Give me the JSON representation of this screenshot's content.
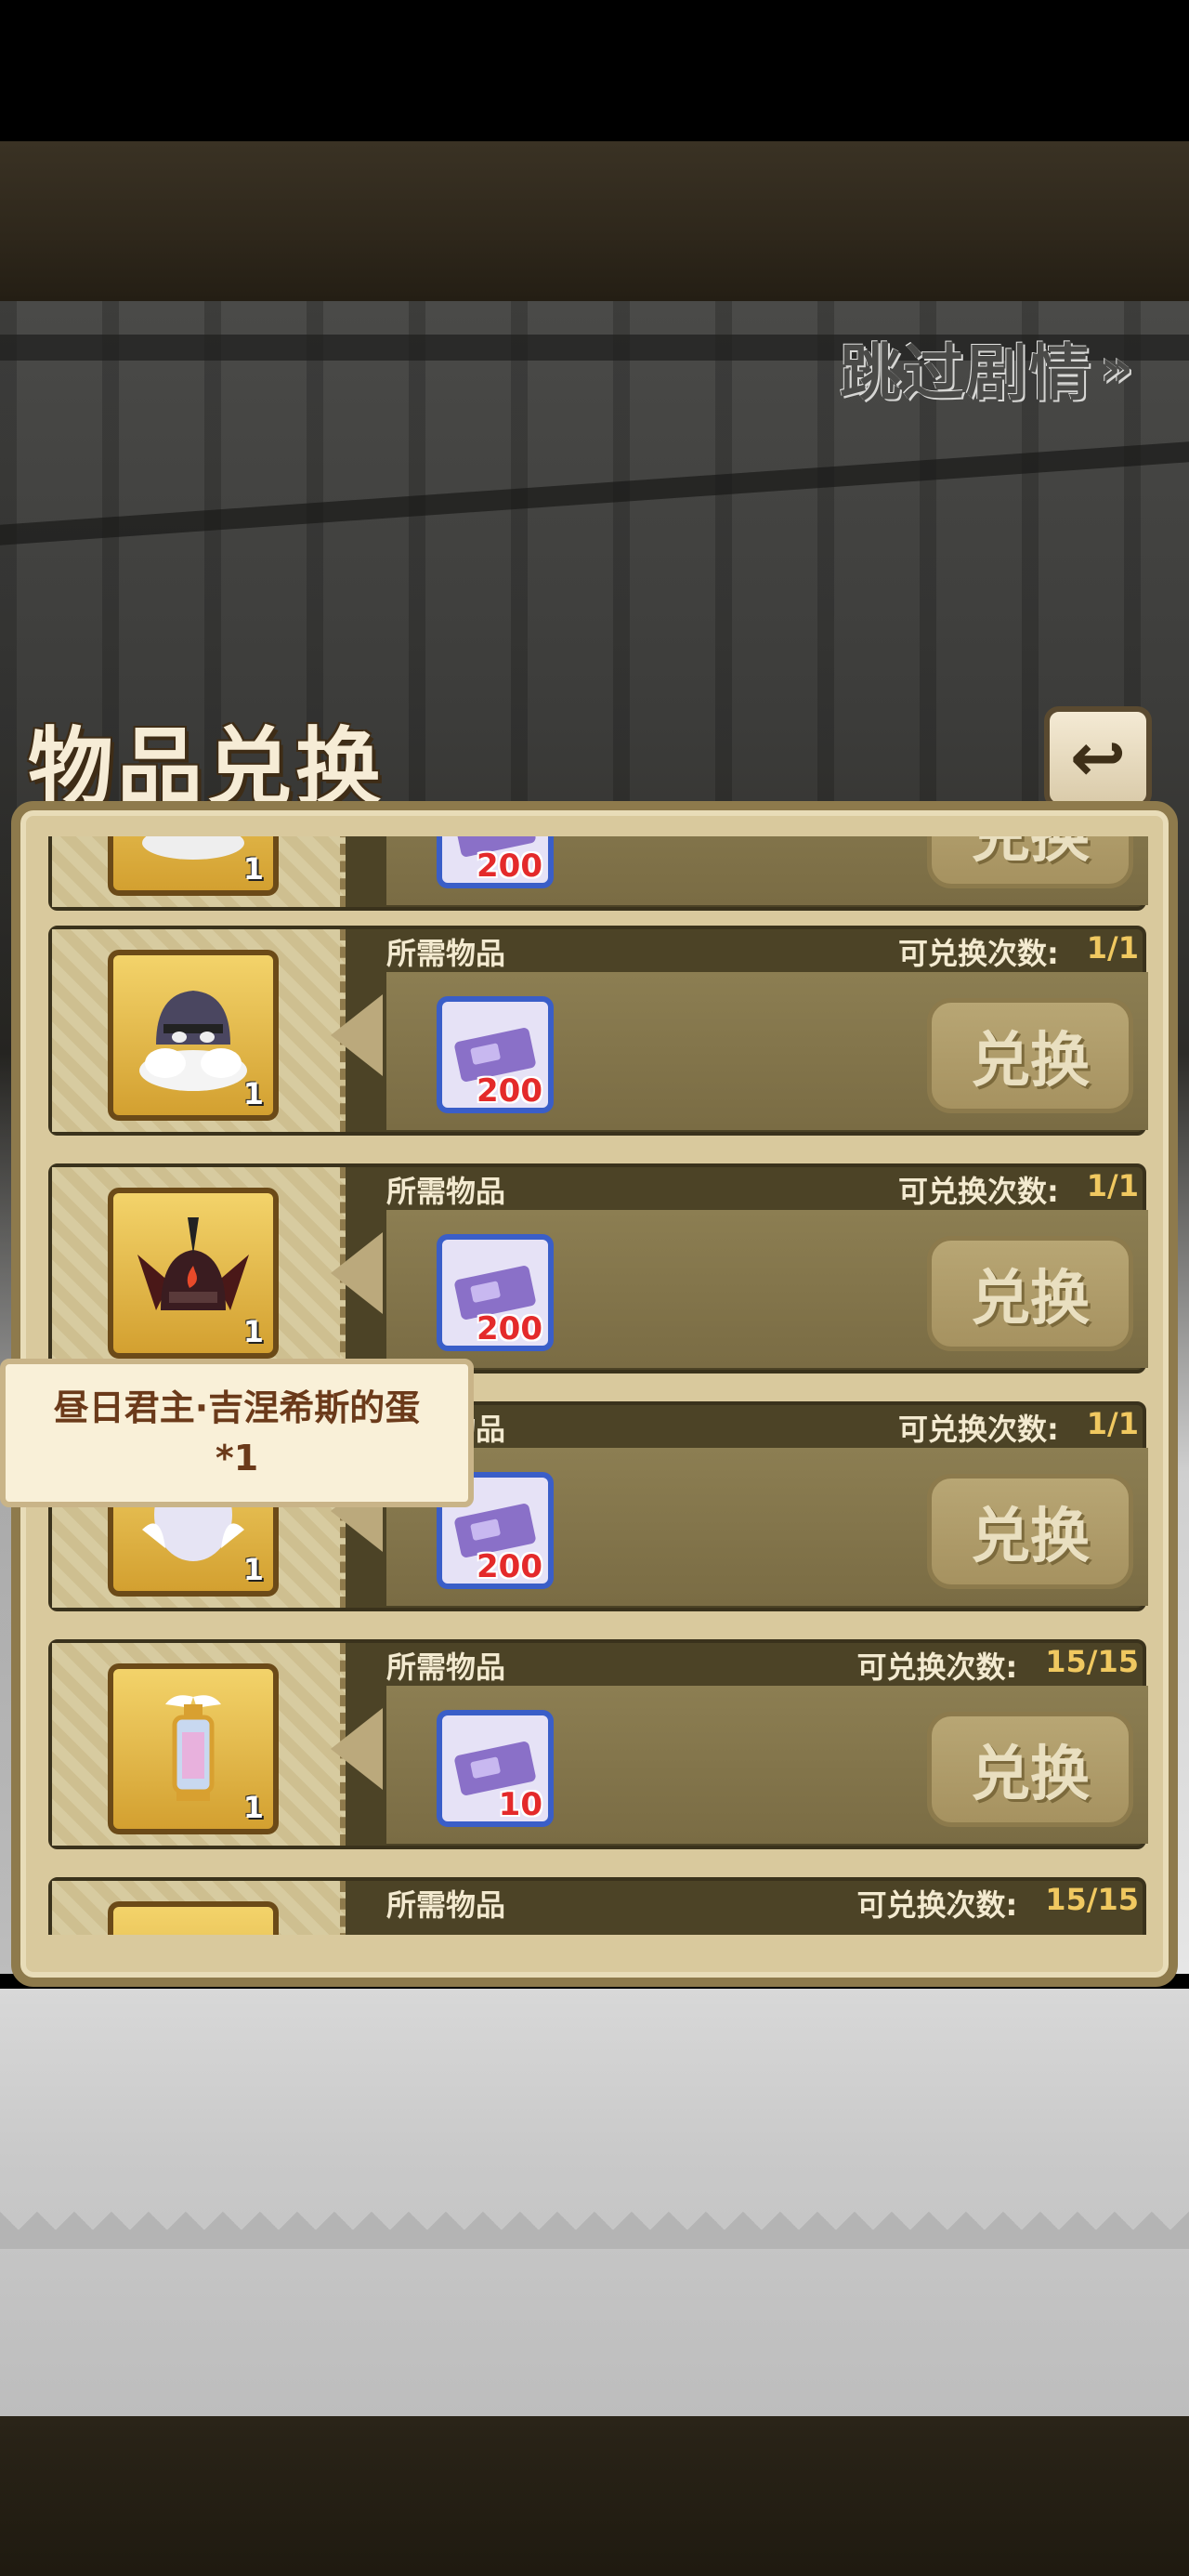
{
  "skip_button": {
    "label": "跳过剧情",
    "chevron": "»"
  },
  "title": "物品兑换",
  "back_icon": "↩",
  "header_labels": {
    "required": "所需物品",
    "times": "可兑换次数:"
  },
  "exchange_label": "兑换",
  "rows": [
    {
      "item_icon": "hood-egg-icon",
      "item_count": "1",
      "cost": "200",
      "times": ""
    },
    {
      "item_icon": "hooded-cloud-icon",
      "item_count": "1",
      "cost": "200",
      "times": "1/1"
    },
    {
      "item_icon": "demon-helm-icon",
      "item_count": "1",
      "cost": "200",
      "times": "1/1"
    },
    {
      "item_icon": "white-egg-icon",
      "item_count": "1",
      "cost": "200",
      "times": "1/1"
    },
    {
      "item_icon": "winged-lantern-icon",
      "item_count": "1",
      "cost": "10",
      "times": "15/15"
    },
    {
      "item_icon": "partial-item-icon",
      "item_count": "",
      "cost": "",
      "times": "15/15"
    }
  ],
  "tooltip": {
    "line1": "昼日君主·吉涅希斯的蛋",
    "line2": "*1"
  },
  "colors": {
    "panel": "#d9c99d",
    "header": "#4c4326",
    "count": "#f0c860",
    "cost_red": "#e42a2a"
  }
}
